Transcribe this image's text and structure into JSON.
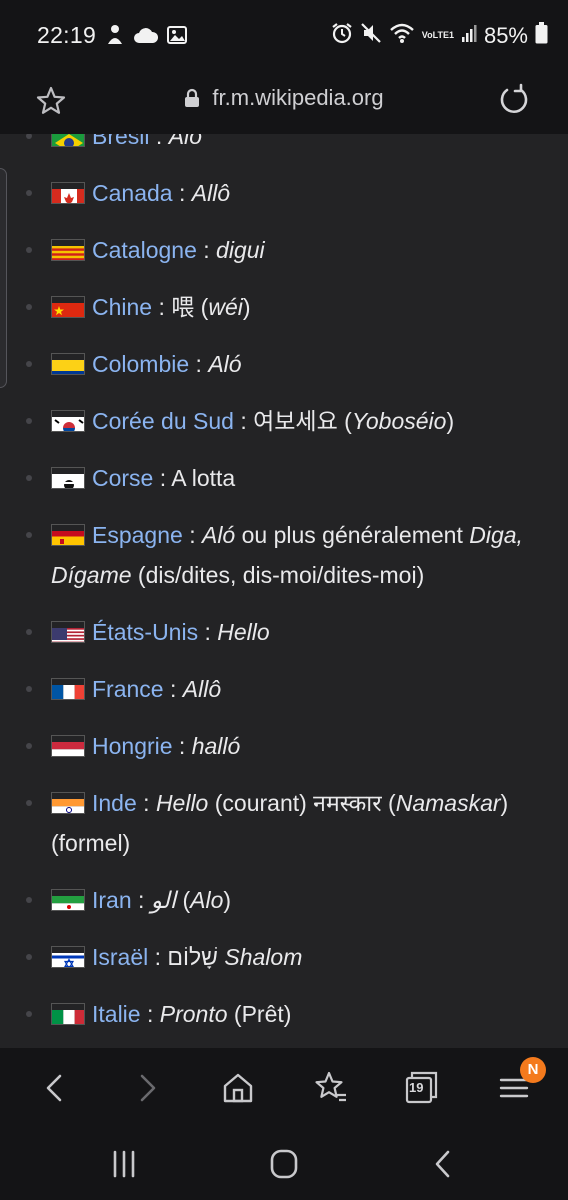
{
  "status": {
    "time": "22:19",
    "network": "VoLTE1",
    "battery": "85%"
  },
  "browser": {
    "url": "fr.m.wikipedia.org",
    "tab_count": "19",
    "badge": "N"
  },
  "colors": {
    "link": "#8bb4f0",
    "background": "#232325",
    "bars": "#141416",
    "badge": "#f47a1d"
  },
  "items": [
    {
      "flag": "brazil",
      "country": "Brésil",
      "parts": [
        [
          " : ",
          ""
        ],
        [
          "Alô",
          "i"
        ]
      ]
    },
    {
      "flag": "canada",
      "country": "Canada",
      "parts": [
        [
          " : ",
          ""
        ],
        [
          "Allô",
          "i"
        ]
      ]
    },
    {
      "flag": "catalonia",
      "country": "Catalogne",
      "parts": [
        [
          " : ",
          ""
        ],
        [
          "digui",
          "i"
        ]
      ]
    },
    {
      "flag": "china",
      "country": "Chine",
      "parts": [
        [
          " : 喂 (",
          ""
        ],
        [
          "wéi",
          "i"
        ],
        [
          ")",
          ""
        ]
      ]
    },
    {
      "flag": "colombia",
      "country": "Colombie",
      "parts": [
        [
          " : ",
          ""
        ],
        [
          "Aló",
          "i"
        ]
      ]
    },
    {
      "flag": "southkorea",
      "country": "Corée du Sud",
      "parts": [
        [
          " : 여보세요 (",
          ""
        ],
        [
          "Yoboséio",
          "i"
        ],
        [
          ")",
          ""
        ]
      ]
    },
    {
      "flag": "corsica",
      "country": "Corse",
      "parts": [
        [
          " : A lotta",
          ""
        ]
      ]
    },
    {
      "flag": "spain",
      "country": "Espagne",
      "parts": [
        [
          " : ",
          ""
        ],
        [
          "Aló",
          "i"
        ],
        [
          " ou plus généralement ",
          ""
        ],
        [
          "Diga, Dígame",
          "i"
        ],
        [
          " (dis/dites, dis-moi/dites-moi)",
          ""
        ]
      ]
    },
    {
      "flag": "usa",
      "country": "États-Unis",
      "parts": [
        [
          " : ",
          ""
        ],
        [
          "Hello",
          "i"
        ]
      ]
    },
    {
      "flag": "france",
      "country": "France",
      "parts": [
        [
          " : ",
          ""
        ],
        [
          "Allô",
          "i"
        ]
      ]
    },
    {
      "flag": "hungary",
      "country": "Hongrie",
      "parts": [
        [
          " : ",
          ""
        ],
        [
          "halló",
          "i"
        ]
      ]
    },
    {
      "flag": "india",
      "country": "Inde",
      "parts": [
        [
          " : ",
          ""
        ],
        [
          "Hello",
          "i"
        ],
        [
          " (courant) नमस्कार (",
          ""
        ],
        [
          "Namaskar",
          "i"
        ],
        [
          ") (formel)",
          ""
        ]
      ]
    },
    {
      "flag": "iran",
      "country": "Iran",
      "parts": [
        [
          " : ",
          ""
        ],
        [
          "الو",
          "i"
        ],
        [
          " (",
          ""
        ],
        [
          "Alo",
          "i"
        ],
        [
          ")",
          ""
        ]
      ]
    },
    {
      "flag": "israel",
      "country": "Israël",
      "parts": [
        [
          " : שָׁלוֹם ",
          ""
        ],
        [
          "Shalom",
          "i"
        ]
      ]
    },
    {
      "flag": "italy",
      "country": "Italie",
      "parts": [
        [
          " : ",
          ""
        ],
        [
          "Pronto",
          "i"
        ],
        [
          " (Prêt)",
          ""
        ]
      ]
    }
  ]
}
